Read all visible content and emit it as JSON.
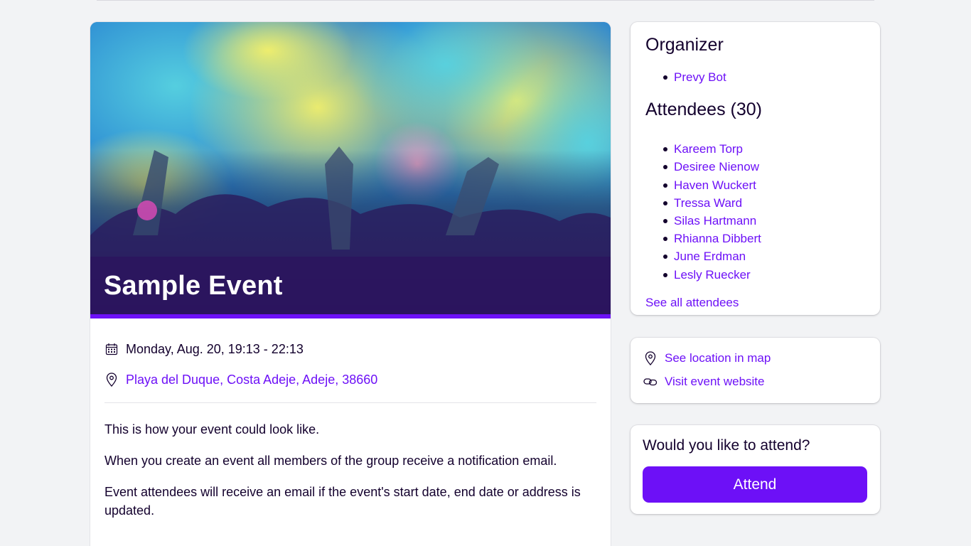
{
  "event": {
    "title": "Sample Event",
    "date": "Monday, Aug. 20, 19:13 - 22:13",
    "address": "Playa del Duque, Costa Adeje, Adeje, 38660",
    "description": [
      "This is how your event could look like.",
      "When you create an event all members of the group receive a notification email.",
      "Event attendees will receive an email if the event's start date, end date or address is updated."
    ]
  },
  "organizer": {
    "heading": "Organizer",
    "names": [
      "Prevy Bot"
    ]
  },
  "attendees": {
    "heading": "Attendees (30)",
    "names": [
      "Kareem Torp",
      "Desiree Nienow",
      "Haven Wuckert",
      "Tressa Ward",
      "Silas Hartmann",
      "Rhianna Dibbert",
      "June Erdman",
      "Lesly Ruecker"
    ],
    "see_all": "See all attendees"
  },
  "links": {
    "map": "See location in map",
    "website": "Visit event website"
  },
  "attend": {
    "question": "Would you like to attend?",
    "button": "Attend"
  },
  "icons": {
    "date": "calendar-icon",
    "address": "location-pin-icon",
    "map": "location-pin-icon",
    "website": "link-icon"
  },
  "colors": {
    "accent": "#6d10f7",
    "text": "#13002d",
    "background": "#f2f3f5"
  }
}
